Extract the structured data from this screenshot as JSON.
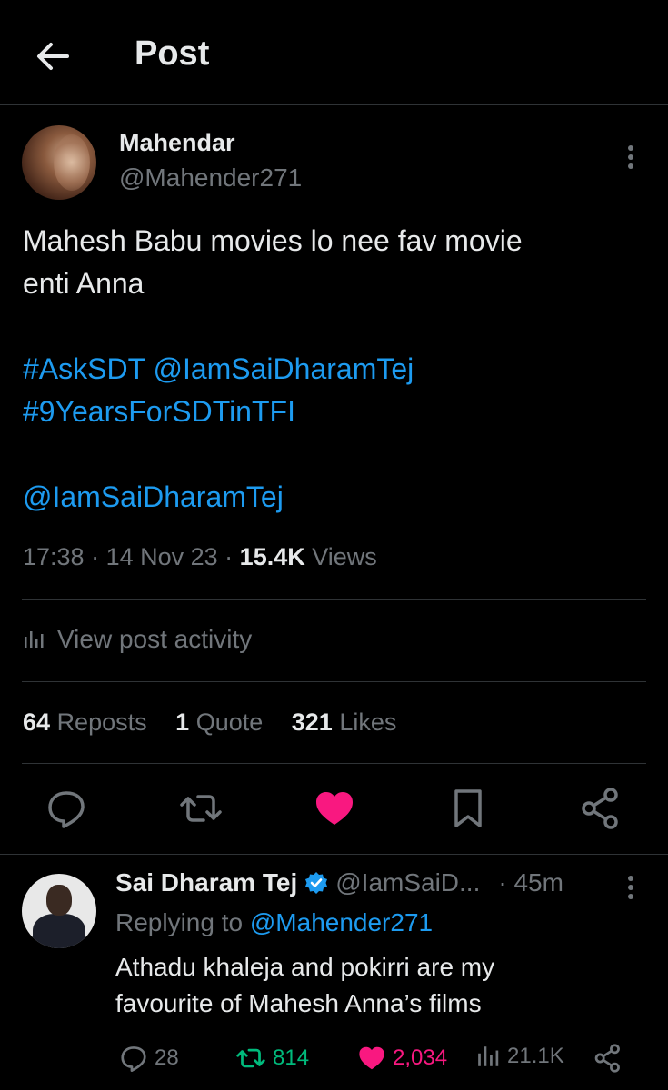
{
  "header": {
    "title": "Post",
    "back_icon": "arrow-left-icon"
  },
  "post": {
    "author_name": "Mahendar",
    "author_handle": "@Mahender271",
    "text_line1": "Mahesh Babu movies lo nee fav movie",
    "text_line2": "enti Anna",
    "hashtag1": "#AskSDT",
    "mention1": "@IamSaiDharamTej",
    "hashtag2": "#9YearsForSDTinTFI",
    "mention2": "@IamSaiDharamTej",
    "time": "17:38",
    "date": "14 Nov 23",
    "views_count": "15.4K",
    "views_label": "Views",
    "activity_label": "View post activity",
    "reposts_count": "64",
    "reposts_label": "Reposts",
    "quotes_count": "1",
    "quotes_label": "Quote",
    "likes_count": "321",
    "likes_label": "Likes",
    "liked": true
  },
  "reply": {
    "author_name": "Sai Dharam Tej",
    "author_handle": "@IamSaiD...",
    "time": "· 45m",
    "replying_prefix": "Replying to",
    "replying_handle": "@Mahender271",
    "text_line1": "Athadu khaleja and pokirri are my",
    "text_line2": "favourite of Mahesh Anna’s films",
    "replies": "28",
    "reposts": "814",
    "likes": "2,034",
    "views": "21.1K"
  },
  "colors": {
    "background": "#000000",
    "text": "#e7e9ea",
    "muted": "#71767b",
    "link": "#1d9bf0",
    "like": "#f91880",
    "repost": "#00ba7c",
    "divider": "#2f3336"
  }
}
